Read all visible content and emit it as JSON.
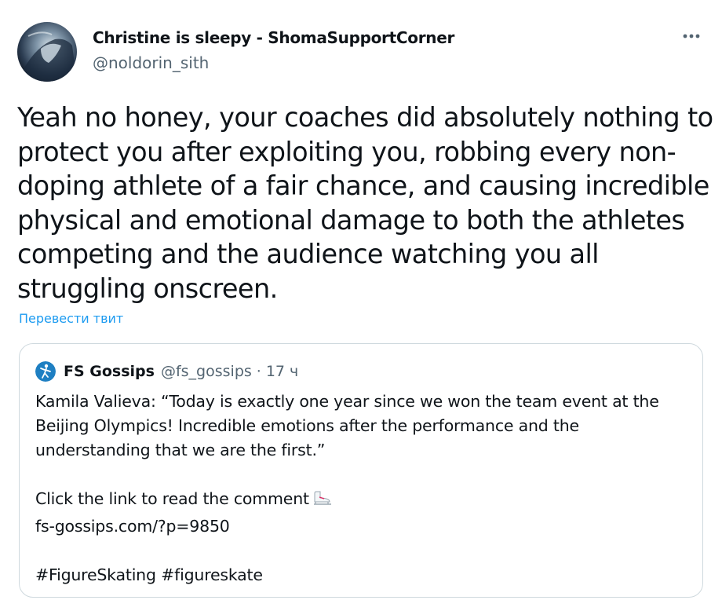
{
  "tweet": {
    "author_name": "Christine is sleepy - ShomaSupportCorner",
    "author_handle": "@noldorin_sith",
    "more_icon": "more-horizontal-icon",
    "text": "Yeah no honey, your coaches did absolutely nothing to protect you after exploiting you, robbing every non-doping athlete of a fair chance, and causing incredible physical and emotional damage to both the athletes competing and the audience watching you all struggling onscreen.",
    "translate_label": "Перевести твит"
  },
  "quote": {
    "author_name": "FS Gossips",
    "author_handle": "@fs_gossips",
    "separator": "·",
    "time": "17 ч",
    "paragraph1": "Kamila Valieva: “Today is exactly one year since we won the team event at the Beijing Olympics! Incredible emotions after the performance and the understanding that we are the first.”",
    "line_click": "Click the link to read the comment",
    "emoji_icon": "ice-skate-icon",
    "link": "fs-gossips.com/?p=9850",
    "hashtags": "#FigureSkating #figureskate"
  },
  "colors": {
    "text": "#0f1419",
    "secondary": "#536471",
    "accent": "#1d9bf0",
    "border": "#cfd9de"
  }
}
